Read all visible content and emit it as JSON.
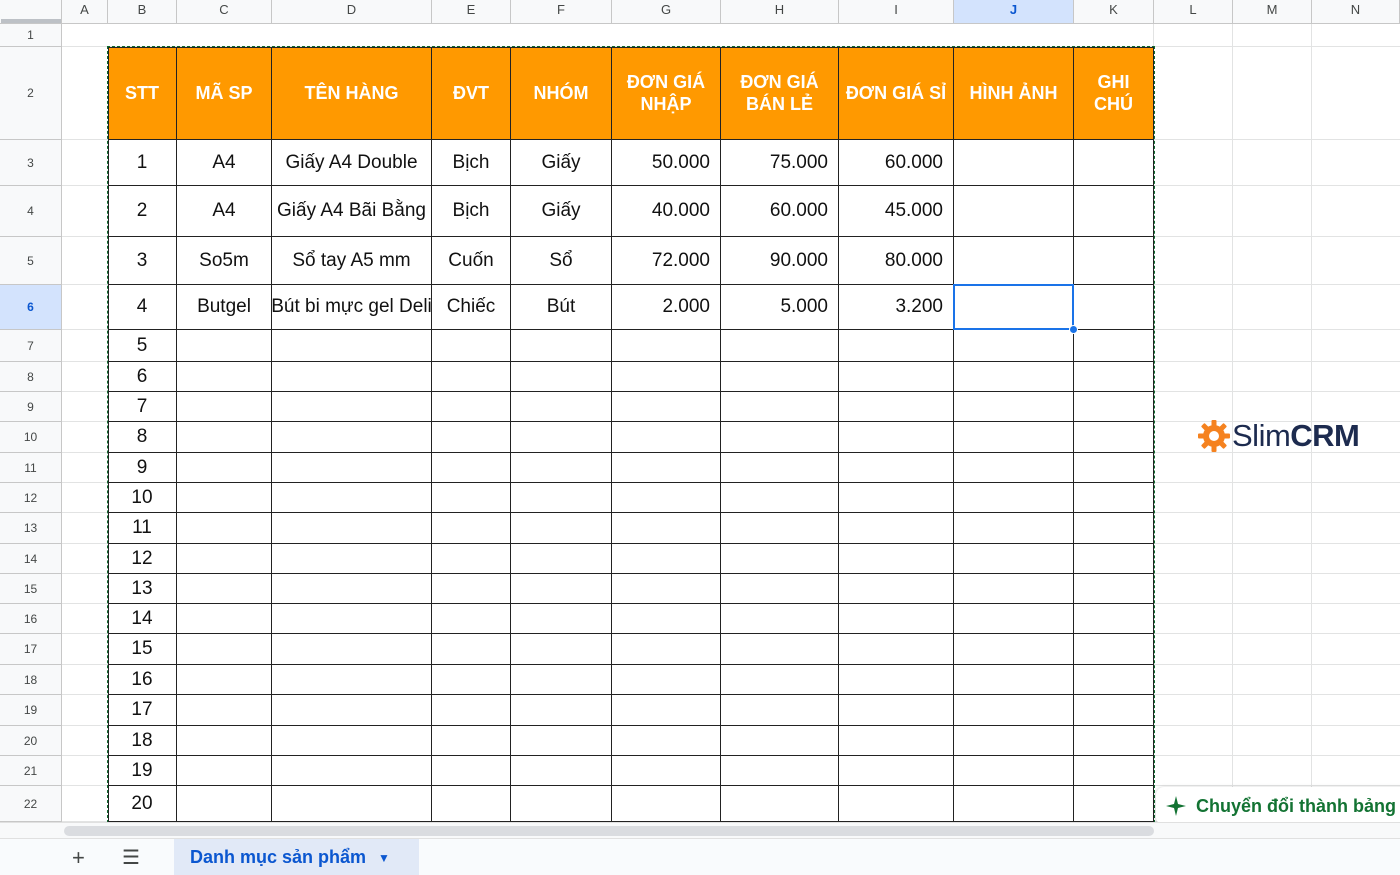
{
  "columns": [
    "A",
    "B",
    "C",
    "D",
    "E",
    "F",
    "G",
    "H",
    "I",
    "J",
    "K",
    "L",
    "M",
    "N"
  ],
  "selected_column": "J",
  "row_numbers": [
    "1",
    "2",
    "3",
    "4",
    "5",
    "6",
    "7",
    "8",
    "9",
    "10",
    "11",
    "12",
    "13",
    "14",
    "15",
    "16",
    "17",
    "18",
    "19",
    "20",
    "21",
    "22"
  ],
  "selected_row": "6",
  "table": {
    "headers": [
      "STT",
      "MÃ SP",
      "TÊN HÀNG",
      "ĐVT",
      "NHÓM",
      "ĐƠN GIÁ NHẬP",
      "ĐƠN GIÁ BÁN LẺ",
      "ĐƠN GIÁ SỈ",
      "HÌNH ẢNH",
      "GHI CHÚ"
    ],
    "rows": [
      [
        "1",
        "A4",
        "Giấy A4 Double",
        "Bịch",
        "Giấy",
        "50.000",
        "75.000",
        "60.000",
        "",
        ""
      ],
      [
        "2",
        "A4",
        "Giấy A4 Bãi Bằng",
        "Bịch",
        "Giấy",
        "40.000",
        "60.000",
        "45.000",
        "",
        ""
      ],
      [
        "3",
        "So5m",
        "Sổ tay A5 mm",
        "Cuốn",
        "Sổ",
        "72.000",
        "90.000",
        "80.000",
        "",
        ""
      ],
      [
        "4",
        "Butgel",
        "Bút bi mực gel Deli",
        "Chiếc",
        "Bút",
        "2.000",
        "5.000",
        "3.200",
        "",
        ""
      ],
      [
        "5",
        "",
        "",
        "",
        "",
        "",
        "",
        "",
        "",
        ""
      ],
      [
        "6",
        "",
        "",
        "",
        "",
        "",
        "",
        "",
        "",
        ""
      ],
      [
        "7",
        "",
        "",
        "",
        "",
        "",
        "",
        "",
        "",
        ""
      ],
      [
        "8",
        "",
        "",
        "",
        "",
        "",
        "",
        "",
        "",
        ""
      ],
      [
        "9",
        "",
        "",
        "",
        "",
        "",
        "",
        "",
        "",
        ""
      ],
      [
        "10",
        "",
        "",
        "",
        "",
        "",
        "",
        "",
        "",
        ""
      ],
      [
        "11",
        "",
        "",
        "",
        "",
        "",
        "",
        "",
        "",
        ""
      ],
      [
        "12",
        "",
        "",
        "",
        "",
        "",
        "",
        "",
        "",
        ""
      ],
      [
        "13",
        "",
        "",
        "",
        "",
        "",
        "",
        "",
        "",
        ""
      ],
      [
        "14",
        "",
        "",
        "",
        "",
        "",
        "",
        "",
        "",
        ""
      ],
      [
        "15",
        "",
        "",
        "",
        "",
        "",
        "",
        "",
        "",
        ""
      ],
      [
        "16",
        "",
        "",
        "",
        "",
        "",
        "",
        "",
        "",
        ""
      ],
      [
        "17",
        "",
        "",
        "",
        "",
        "",
        "",
        "",
        "",
        ""
      ],
      [
        "18",
        "",
        "",
        "",
        "",
        "",
        "",
        "",
        "",
        ""
      ],
      [
        "19",
        "",
        "",
        "",
        "",
        "",
        "",
        "",
        "",
        ""
      ],
      [
        "20",
        "",
        "",
        "",
        "",
        "",
        "",
        "",
        "",
        ""
      ]
    ]
  },
  "logo": {
    "slim": "Slim",
    "crm": "CRM"
  },
  "convert_chip": {
    "label": "Chuyển đổi thành bảng"
  },
  "tabbar": {
    "add_icon": "+",
    "menu_icon": "☰",
    "sheet_tab": "Danh mục sản phẩm",
    "caret": "▼"
  },
  "colors": {
    "header_fill": "#ff9900",
    "accent_blue": "#1a73e8",
    "chip_green": "#137333",
    "logo_gear": "#f5821f",
    "logo_text": "#1d2b4f"
  }
}
